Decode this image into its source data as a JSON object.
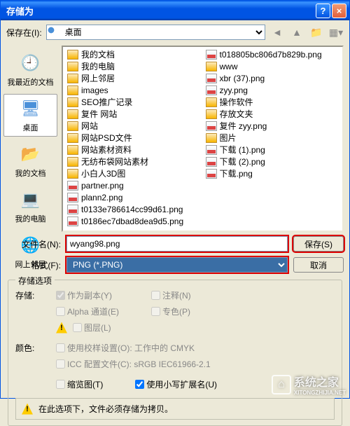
{
  "title": "存储为",
  "savein_label": "保存在(I):",
  "savein_value": "桌面",
  "places": [
    {
      "label": "我最近的文档",
      "icon": "recent"
    },
    {
      "label": "桌面",
      "icon": "desktop",
      "selected": true
    },
    {
      "label": "我的文档",
      "icon": "docs"
    },
    {
      "label": "我的电脑",
      "icon": "computer"
    },
    {
      "label": "网上邻居",
      "icon": "network"
    }
  ],
  "files_col1": [
    {
      "name": "我的文档",
      "type": "folder"
    },
    {
      "name": "我的电脑",
      "type": "folder"
    },
    {
      "name": "网上邻居",
      "type": "folder"
    },
    {
      "name": "images",
      "type": "folder"
    },
    {
      "name": "SEO推广记录",
      "type": "folder"
    },
    {
      "name": "复件 网站",
      "type": "folder"
    },
    {
      "name": "网站",
      "type": "folder"
    },
    {
      "name": "网站PSD文件",
      "type": "folder"
    },
    {
      "name": "网站素材资料",
      "type": "folder"
    },
    {
      "name": "无纺布袋网站素材",
      "type": "folder"
    },
    {
      "name": "小白人3D图",
      "type": "folder"
    },
    {
      "name": "partner.png",
      "type": "png"
    },
    {
      "name": "plann2.png",
      "type": "png"
    },
    {
      "name": "t0133e786614cc99d61.png",
      "type": "png"
    },
    {
      "name": "t0186ec7dbad8dea9d5.png",
      "type": "png"
    }
  ],
  "files_col2": [
    {
      "name": "t018805bc806d7b829b.png",
      "type": "png"
    },
    {
      "name": "www",
      "type": "folder"
    },
    {
      "name": "xbr (37).png",
      "type": "png"
    },
    {
      "name": "zyy.png",
      "type": "png"
    },
    {
      "name": "操作软件",
      "type": "folder"
    },
    {
      "name": "存放文夹",
      "type": "folder"
    },
    {
      "name": "复件 zyy.png",
      "type": "png"
    },
    {
      "name": "图片",
      "type": "folder"
    },
    {
      "name": "下载 (1).png",
      "type": "png"
    },
    {
      "name": "下载 (2).png",
      "type": "png"
    },
    {
      "name": "下载.png",
      "type": "png"
    }
  ],
  "filename_label": "文件名(N):",
  "filename_value": "wyang98.png",
  "format_label": "格式(F):",
  "format_value": "PNG (*.PNG)",
  "save_btn": "保存(S)",
  "cancel_btn": "取消",
  "storage_legend": "存储选项",
  "storage_label": "存储:",
  "opt_copy": "作为副本(Y)",
  "opt_note": "注释(N)",
  "opt_alpha": "Alpha 通道(E)",
  "opt_spot": "专色(P)",
  "opt_layer": "图层(L)",
  "color_label": "颜色:",
  "opt_proof": "使用校样设置(O): 工作中的 CMYK",
  "opt_icc": "ICC 配置文件(C): sRGB IEC61966-2.1",
  "opt_thumb": "缩览图(T)",
  "opt_lowerext": "使用小写扩展名(U)",
  "warn_text": "在此选项下，文件必须存储为拷贝。",
  "watermark": "系统之家",
  "watermark_sub": "XITONGZHIJIA.NET"
}
